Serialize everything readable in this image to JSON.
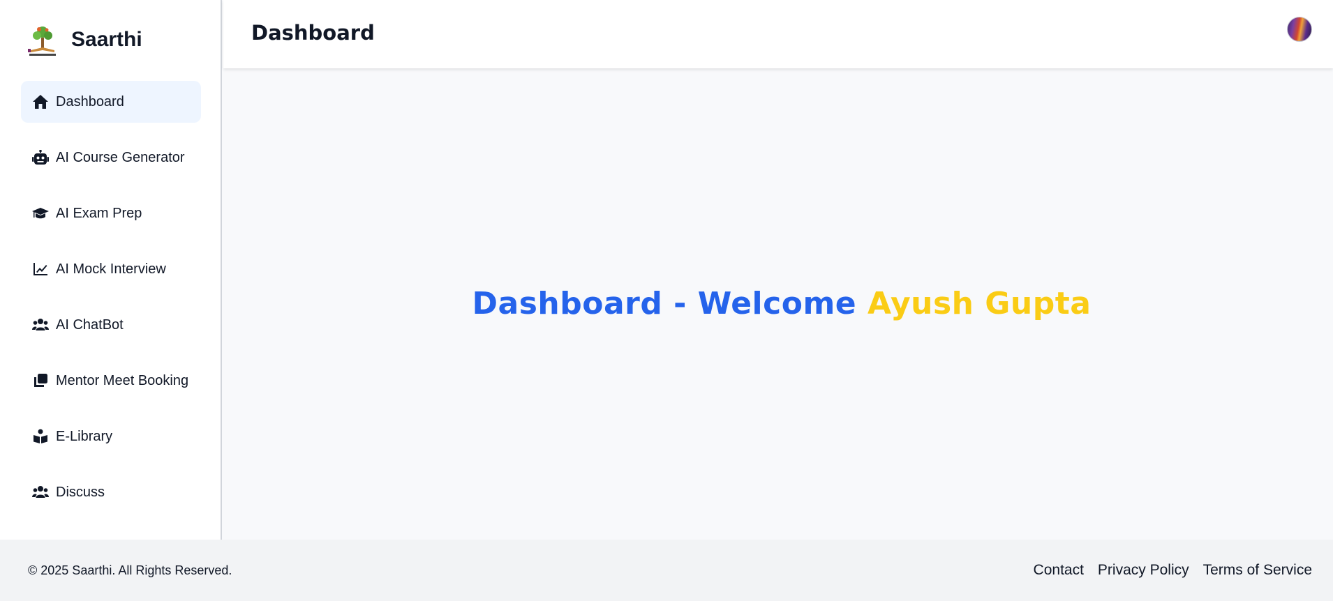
{
  "brand": {
    "name": "Saarthi",
    "logo_icon": "tree-book-logo"
  },
  "sidebar": {
    "items": [
      {
        "label": "Dashboard",
        "icon": "home-icon",
        "active": true
      },
      {
        "label": "AI Course Generator",
        "icon": "robot-icon"
      },
      {
        "label": "AI Exam Prep",
        "icon": "graduation-cap-icon"
      },
      {
        "label": "AI Mock Interview",
        "icon": "line-chart-icon"
      },
      {
        "label": "AI ChatBot",
        "icon": "users-icon"
      },
      {
        "label": "Mentor Meet Booking",
        "icon": "clone-icon"
      },
      {
        "label": "E-Library",
        "icon": "book-reader-icon"
      },
      {
        "label": "Discuss",
        "icon": "users-icon"
      }
    ]
  },
  "header": {
    "title": "Dashboard",
    "avatar_icon": "user-avatar"
  },
  "main": {
    "welcome_prefix": "Dashboard - Welcome",
    "user_name": "Ayush Gupta"
  },
  "footer": {
    "copyright": "© 2025 Saarthi. All Rights Reserved.",
    "links": [
      "Contact",
      "Privacy Policy",
      "Terms of Service"
    ]
  },
  "colors": {
    "accent_blue": "#2563eb",
    "accent_yellow": "#facc15",
    "active_nav_bg": "#eef5ff"
  }
}
